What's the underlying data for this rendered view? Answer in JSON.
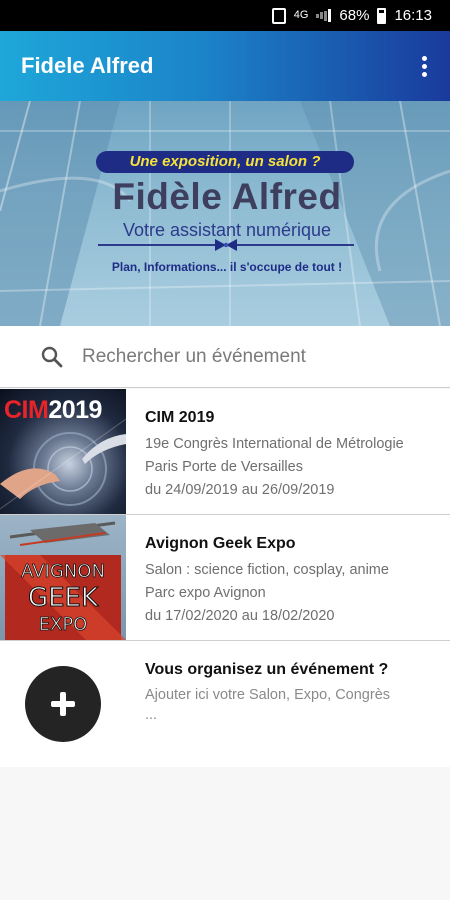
{
  "status_bar": {
    "data_label": "4G",
    "battery_percent": "68%",
    "time": "16:13"
  },
  "app_bar": {
    "title": "Fidele Alfred",
    "menu_icon": "more-vert-icon"
  },
  "banner": {
    "pill_text": "Une exposition, un salon ?",
    "title": "Fidèle Alfred",
    "subtitle": "Votre assistant numérique",
    "tagline": "Plan, Informations... il s'occupe de tout !"
  },
  "search": {
    "icon": "search-icon",
    "placeholder": "Rechercher un événement"
  },
  "events": [
    {
      "thumb_label_a": "CIM",
      "thumb_label_b": "2019",
      "title": "CIM 2019",
      "description": "19e Congrès International de Métrologie",
      "location": "Paris Porte de Versailles",
      "dates": "du 24/09/2019 au 26/09/2019"
    },
    {
      "title": "Avignon Geek Expo",
      "description": "Salon : science fiction, cosplay, anime",
      "location": "Parc expo Avignon",
      "dates": "du 17/02/2020 au 18/02/2020"
    }
  ],
  "add_event": {
    "icon": "add-circle-icon",
    "title": "Vous organisez un événement ?",
    "line1": "Ajouter ici votre Salon, Expo, Congrès",
    "line2": "..."
  },
  "colors": {
    "appbar_start": "#1ea7d9",
    "appbar_end": "#1a3a9c",
    "accent_yellow": "#f5e23b",
    "brand_navy": "#1f2c86"
  }
}
